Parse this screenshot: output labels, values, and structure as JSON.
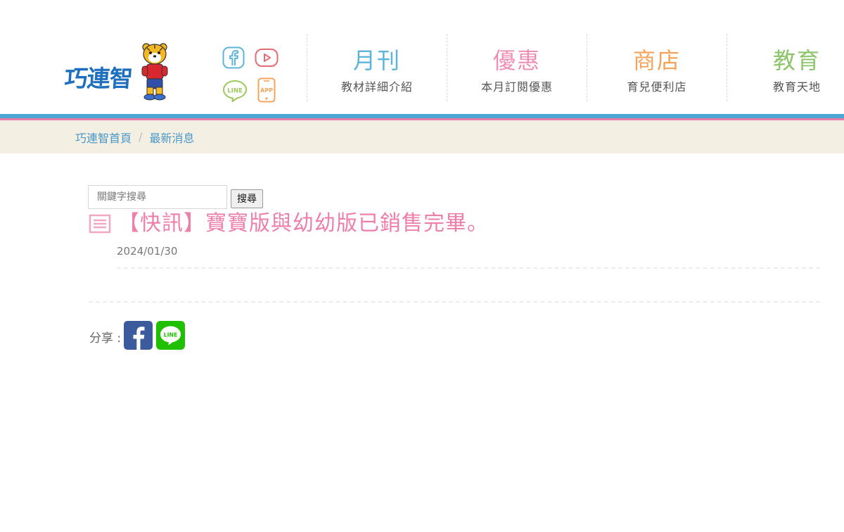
{
  "brand": {
    "name": "巧連智"
  },
  "social": {
    "icons": [
      "facebook-icon",
      "youtube-icon",
      "line-icon",
      "app-icon"
    ],
    "line_text": "LINE",
    "app_text": "APP"
  },
  "nav": [
    {
      "title": "月刊",
      "subtitle": "教材詳細介紹",
      "color": "#5bb4da"
    },
    {
      "title": "優惠",
      "subtitle": "本月訂閱優惠",
      "color": "#ef8fb3"
    },
    {
      "title": "商店",
      "subtitle": "育兒便利店",
      "color": "#f4a45a"
    },
    {
      "title": "教育",
      "subtitle": "教育天地",
      "color": "#8cc46a"
    }
  ],
  "breadcrumb": {
    "home": "巧連智首頁",
    "separator": "/",
    "current": "最新消息"
  },
  "search": {
    "placeholder": "關鍵字搜尋",
    "value": "",
    "button_label": "搜尋"
  },
  "article": {
    "title": "【快訊】寶寶版與幼幼版已銷售完畢。",
    "date": "2024/01/30"
  },
  "share": {
    "label": "分享 :",
    "icons": [
      "facebook-share-icon",
      "line-share-icon"
    ],
    "line_text": "LINE"
  },
  "colors": {
    "accent_blue": "#4aa7d3",
    "accent_pink": "#e97ba6",
    "breadcrumb_bg": "#f3efe2",
    "title_pink": "#ee7fa9"
  }
}
